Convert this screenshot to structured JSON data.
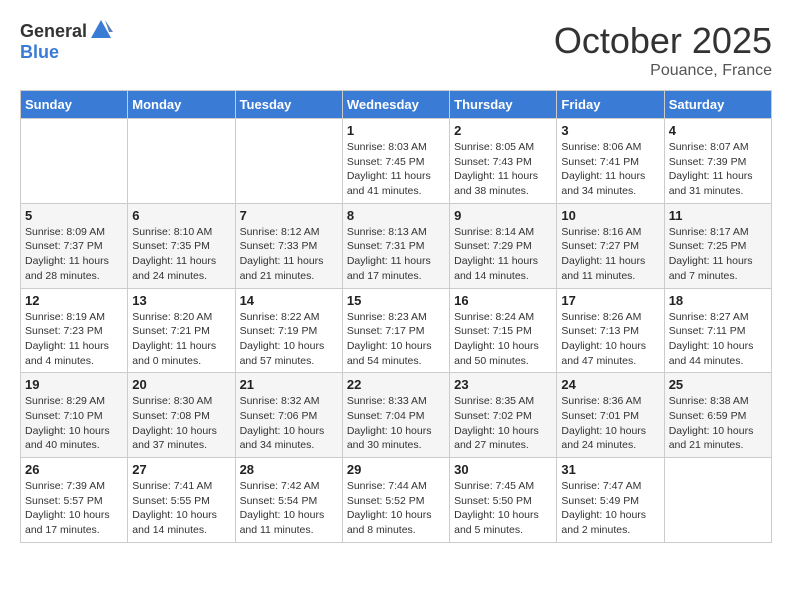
{
  "header": {
    "logo_general": "General",
    "logo_blue": "Blue",
    "month": "October 2025",
    "location": "Pouance, France"
  },
  "days_of_week": [
    "Sunday",
    "Monday",
    "Tuesday",
    "Wednesday",
    "Thursday",
    "Friday",
    "Saturday"
  ],
  "weeks": [
    [
      {
        "day": "",
        "sunrise": "",
        "sunset": "",
        "daylight": ""
      },
      {
        "day": "",
        "sunrise": "",
        "sunset": "",
        "daylight": ""
      },
      {
        "day": "",
        "sunrise": "",
        "sunset": "",
        "daylight": ""
      },
      {
        "day": "1",
        "sunrise": "Sunrise: 8:03 AM",
        "sunset": "Sunset: 7:45 PM",
        "daylight": "Daylight: 11 hours and 41 minutes."
      },
      {
        "day": "2",
        "sunrise": "Sunrise: 8:05 AM",
        "sunset": "Sunset: 7:43 PM",
        "daylight": "Daylight: 11 hours and 38 minutes."
      },
      {
        "day": "3",
        "sunrise": "Sunrise: 8:06 AM",
        "sunset": "Sunset: 7:41 PM",
        "daylight": "Daylight: 11 hours and 34 minutes."
      },
      {
        "day": "4",
        "sunrise": "Sunrise: 8:07 AM",
        "sunset": "Sunset: 7:39 PM",
        "daylight": "Daylight: 11 hours and 31 minutes."
      }
    ],
    [
      {
        "day": "5",
        "sunrise": "Sunrise: 8:09 AM",
        "sunset": "Sunset: 7:37 PM",
        "daylight": "Daylight: 11 hours and 28 minutes."
      },
      {
        "day": "6",
        "sunrise": "Sunrise: 8:10 AM",
        "sunset": "Sunset: 7:35 PM",
        "daylight": "Daylight: 11 hours and 24 minutes."
      },
      {
        "day": "7",
        "sunrise": "Sunrise: 8:12 AM",
        "sunset": "Sunset: 7:33 PM",
        "daylight": "Daylight: 11 hours and 21 minutes."
      },
      {
        "day": "8",
        "sunrise": "Sunrise: 8:13 AM",
        "sunset": "Sunset: 7:31 PM",
        "daylight": "Daylight: 11 hours and 17 minutes."
      },
      {
        "day": "9",
        "sunrise": "Sunrise: 8:14 AM",
        "sunset": "Sunset: 7:29 PM",
        "daylight": "Daylight: 11 hours and 14 minutes."
      },
      {
        "day": "10",
        "sunrise": "Sunrise: 8:16 AM",
        "sunset": "Sunset: 7:27 PM",
        "daylight": "Daylight: 11 hours and 11 minutes."
      },
      {
        "day": "11",
        "sunrise": "Sunrise: 8:17 AM",
        "sunset": "Sunset: 7:25 PM",
        "daylight": "Daylight: 11 hours and 7 minutes."
      }
    ],
    [
      {
        "day": "12",
        "sunrise": "Sunrise: 8:19 AM",
        "sunset": "Sunset: 7:23 PM",
        "daylight": "Daylight: 11 hours and 4 minutes."
      },
      {
        "day": "13",
        "sunrise": "Sunrise: 8:20 AM",
        "sunset": "Sunset: 7:21 PM",
        "daylight": "Daylight: 11 hours and 0 minutes."
      },
      {
        "day": "14",
        "sunrise": "Sunrise: 8:22 AM",
        "sunset": "Sunset: 7:19 PM",
        "daylight": "Daylight: 10 hours and 57 minutes."
      },
      {
        "day": "15",
        "sunrise": "Sunrise: 8:23 AM",
        "sunset": "Sunset: 7:17 PM",
        "daylight": "Daylight: 10 hours and 54 minutes."
      },
      {
        "day": "16",
        "sunrise": "Sunrise: 8:24 AM",
        "sunset": "Sunset: 7:15 PM",
        "daylight": "Daylight: 10 hours and 50 minutes."
      },
      {
        "day": "17",
        "sunrise": "Sunrise: 8:26 AM",
        "sunset": "Sunset: 7:13 PM",
        "daylight": "Daylight: 10 hours and 47 minutes."
      },
      {
        "day": "18",
        "sunrise": "Sunrise: 8:27 AM",
        "sunset": "Sunset: 7:11 PM",
        "daylight": "Daylight: 10 hours and 44 minutes."
      }
    ],
    [
      {
        "day": "19",
        "sunrise": "Sunrise: 8:29 AM",
        "sunset": "Sunset: 7:10 PM",
        "daylight": "Daylight: 10 hours and 40 minutes."
      },
      {
        "day": "20",
        "sunrise": "Sunrise: 8:30 AM",
        "sunset": "Sunset: 7:08 PM",
        "daylight": "Daylight: 10 hours and 37 minutes."
      },
      {
        "day": "21",
        "sunrise": "Sunrise: 8:32 AM",
        "sunset": "Sunset: 7:06 PM",
        "daylight": "Daylight: 10 hours and 34 minutes."
      },
      {
        "day": "22",
        "sunrise": "Sunrise: 8:33 AM",
        "sunset": "Sunset: 7:04 PM",
        "daylight": "Daylight: 10 hours and 30 minutes."
      },
      {
        "day": "23",
        "sunrise": "Sunrise: 8:35 AM",
        "sunset": "Sunset: 7:02 PM",
        "daylight": "Daylight: 10 hours and 27 minutes."
      },
      {
        "day": "24",
        "sunrise": "Sunrise: 8:36 AM",
        "sunset": "Sunset: 7:01 PM",
        "daylight": "Daylight: 10 hours and 24 minutes."
      },
      {
        "day": "25",
        "sunrise": "Sunrise: 8:38 AM",
        "sunset": "Sunset: 6:59 PM",
        "daylight": "Daylight: 10 hours and 21 minutes."
      }
    ],
    [
      {
        "day": "26",
        "sunrise": "Sunrise: 7:39 AM",
        "sunset": "Sunset: 5:57 PM",
        "daylight": "Daylight: 10 hours and 17 minutes."
      },
      {
        "day": "27",
        "sunrise": "Sunrise: 7:41 AM",
        "sunset": "Sunset: 5:55 PM",
        "daylight": "Daylight: 10 hours and 14 minutes."
      },
      {
        "day": "28",
        "sunrise": "Sunrise: 7:42 AM",
        "sunset": "Sunset: 5:54 PM",
        "daylight": "Daylight: 10 hours and 11 minutes."
      },
      {
        "day": "29",
        "sunrise": "Sunrise: 7:44 AM",
        "sunset": "Sunset: 5:52 PM",
        "daylight": "Daylight: 10 hours and 8 minutes."
      },
      {
        "day": "30",
        "sunrise": "Sunrise: 7:45 AM",
        "sunset": "Sunset: 5:50 PM",
        "daylight": "Daylight: 10 hours and 5 minutes."
      },
      {
        "day": "31",
        "sunrise": "Sunrise: 7:47 AM",
        "sunset": "Sunset: 5:49 PM",
        "daylight": "Daylight: 10 hours and 2 minutes."
      },
      {
        "day": "",
        "sunrise": "",
        "sunset": "",
        "daylight": ""
      }
    ]
  ]
}
